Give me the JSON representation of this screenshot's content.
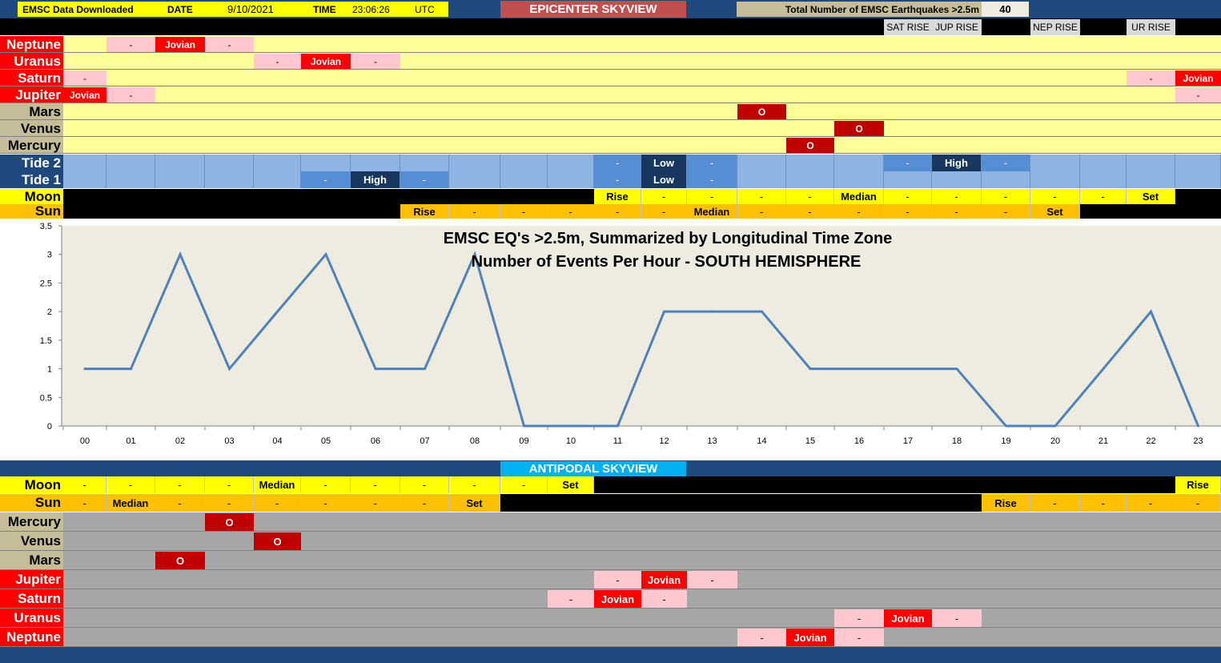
{
  "header": {
    "downloaded_label": "EMSC Data Downloaded",
    "date_label": "DATE",
    "date_value": "9/10/2021",
    "time_label": "TIME",
    "time_value": "23:06:26",
    "tz_label": "UTC",
    "title": "EPICENTER SKYVIEW",
    "total_label": "Total Number of EMSC Earthquakes >2.5m",
    "total_value": "40",
    "sat_rise": "SAT RISE",
    "jup_rise": "JUP RISE",
    "nep_rise": "NEP RISE",
    "ur_rise": "UR RISE"
  },
  "colors": {
    "navy": "#1f497d",
    "yellow_pale": "#ffff99",
    "pink": "#ffc7ce",
    "red": "#ff0000",
    "dark_red": "#c00000",
    "tide_light": "#8eb4e3",
    "tide_mid": "#558ed5",
    "tide_dark": "#17375e",
    "moon_yellow": "#ffff00",
    "sun_orange": "#ffc000",
    "chart_bg": "#eeece1",
    "line": "#4f81bd",
    "grey": "#a6a6a6",
    "tan": "#c4bd97",
    "antipodal_cyan": "#00b0f0"
  },
  "epicenter": {
    "rows": [
      {
        "label": "Neptune",
        "cells": [
          "",
          "-",
          "Jovian",
          "-",
          "",
          "",
          "",
          "",
          "",
          "",
          "",
          "",
          "",
          "",
          "",
          "",
          "",
          "",
          "",
          "",
          "",
          "",
          "",
          ""
        ]
      },
      {
        "label": "Uranus",
        "cells": [
          "",
          "",
          "",
          "",
          "-",
          "Jovian",
          "-",
          "",
          "",
          "",
          "",
          "",
          "",
          "",
          "",
          "",
          "",
          "",
          "",
          "",
          "",
          "",
          "",
          ""
        ]
      },
      {
        "label": "Saturn",
        "cells": [
          "-",
          "",
          "",
          "",
          "",
          "",
          "",
          "",
          "",
          "",
          "",
          "",
          "",
          "",
          "",
          "",
          "",
          "",
          "",
          "",
          "",
          "",
          "-",
          "Jovian"
        ]
      },
      {
        "label": "Jupiter",
        "cells": [
          "Jovian",
          "-",
          "",
          "",
          "",
          "",
          "",
          "",
          "",
          "",
          "",
          "",
          "",
          "",
          "",
          "",
          "",
          "",
          "",
          "",
          "",
          "",
          "",
          "-"
        ]
      },
      {
        "label": "Mars",
        "cells": [
          "",
          "",
          "",
          "",
          "",
          "",
          "",
          "",
          "",
          "",
          "",
          "",
          "",
          "",
          "O",
          "",
          "",
          "",
          "",
          "",
          "",
          "",
          "",
          ""
        ]
      },
      {
        "label": "Venus",
        "cells": [
          "",
          "",
          "",
          "",
          "",
          "",
          "",
          "",
          "",
          "",
          "",
          "",
          "",
          "",
          "",
          "",
          "O",
          "",
          "",
          "",
          "",
          "",
          "",
          ""
        ]
      },
      {
        "label": "Mercury",
        "cells": [
          "",
          "",
          "",
          "",
          "",
          "",
          "",
          "",
          "",
          "",
          "",
          "",
          "",
          "",
          "",
          "O",
          "",
          "",
          "",
          "",
          "",
          "",
          "",
          ""
        ]
      }
    ],
    "tide2_label": "Tide 2",
    "tide2": [
      "",
      "",
      "",
      "",
      "",
      "",
      "",
      "",
      "",
      "",
      "",
      "-",
      "Low",
      "-",
      "",
      "",
      "",
      "-",
      "High",
      "-",
      "",
      "",
      "",
      ""
    ],
    "tide1_label": "Tide 1",
    "tide1": [
      "",
      "",
      "",
      "",
      "",
      "-",
      "High",
      "-",
      "",
      "",
      "",
      "-",
      "Low",
      "-",
      "",
      "",
      "",
      "",
      "",
      "",
      "",
      "",
      "",
      ""
    ],
    "moon_label": "Moon",
    "moon": [
      "",
      "",
      "",
      "",
      "",
      "",
      "",
      "",
      "",
      "",
      "",
      "Rise",
      "-",
      "-",
      "-",
      "-",
      "Median",
      "-",
      "-",
      "-",
      "-",
      "-",
      "Set",
      ""
    ],
    "sun_label": "Sun",
    "sun": [
      "",
      "",
      "",
      "",
      "",
      "",
      "",
      "Rise",
      "-",
      "-",
      "-",
      "-",
      "-",
      "Median",
      "-",
      "-",
      "-",
      "-",
      "-",
      "-",
      "Set",
      "",
      "",
      ""
    ]
  },
  "antipodal": {
    "title": "ANTIPODAL SKYVIEW",
    "moon_label": "Moon",
    "moon": [
      "-",
      "-",
      "-",
      "-",
      "Median",
      "-",
      "-",
      "-",
      "-",
      "-",
      "Set",
      "",
      "",
      "",
      "",
      "",
      "",
      "",
      "",
      "",
      "",
      "",
      "",
      "Rise"
    ],
    "sun_label": "Sun",
    "sun": [
      "-",
      "Median",
      "-",
      "-",
      "-",
      "-",
      "-",
      "-",
      "Set",
      "",
      "",
      "",
      "",
      "",
      "",
      "",
      "",
      "",
      "",
      "Rise",
      "-",
      "-",
      "-",
      "-"
    ],
    "rows": [
      {
        "label": "Mercury",
        "cells": [
          "",
          "",
          "",
          "O",
          "",
          "",
          "",
          "",
          "",
          "",
          "",
          "",
          "",
          "",
          "",
          "",
          "",
          "",
          "",
          "",
          "",
          "",
          "",
          ""
        ]
      },
      {
        "label": "Venus",
        "cells": [
          "",
          "",
          "",
          "",
          "O",
          "",
          "",
          "",
          "",
          "",
          "",
          "",
          "",
          "",
          "",
          "",
          "",
          "",
          "",
          "",
          "",
          "",
          "",
          ""
        ]
      },
      {
        "label": "Mars",
        "cells": [
          "",
          "",
          "O",
          "",
          "",
          "",
          "",
          "",
          "",
          "",
          "",
          "",
          "",
          "",
          "",
          "",
          "",
          "",
          "",
          "",
          "",
          "",
          "",
          ""
        ]
      },
      {
        "label": "Jupiter",
        "cells": [
          "",
          "",
          "",
          "",
          "",
          "",
          "",
          "",
          "",
          "",
          "",
          "-",
          "Jovian",
          "-",
          "",
          "",
          "",
          "",
          "",
          "",
          "",
          "",
          "",
          ""
        ]
      },
      {
        "label": "Saturn",
        "cells": [
          "",
          "",
          "",
          "",
          "",
          "",
          "",
          "",
          "",
          "",
          "-",
          "Jovian",
          "-",
          "",
          "",
          "",
          "",
          "",
          "",
          "",
          "",
          "",
          "",
          ""
        ]
      },
      {
        "label": "Uranus",
        "cells": [
          "",
          "",
          "",
          "",
          "",
          "",
          "",
          "",
          "",
          "",
          "",
          "",
          "",
          "",
          "",
          "",
          "-",
          "Jovian",
          "-",
          "",
          "",
          "",
          "",
          ""
        ]
      },
      {
        "label": "Neptune",
        "cells": [
          "",
          "",
          "",
          "",
          "",
          "",
          "",
          "",
          "",
          "",
          "",
          "",
          "",
          "",
          "-",
          "Jovian",
          "-",
          "",
          "",
          "",
          "",
          "",
          "",
          ""
        ]
      }
    ]
  },
  "chart_data": {
    "type": "line",
    "title": "EMSC EQ's >2.5m, Summarized by Longitudinal Time Zone",
    "subtitle": "Number of Events Per Hour - SOUTH HEMISPHERE",
    "categories": [
      "00",
      "01",
      "02",
      "03",
      "04",
      "05",
      "06",
      "07",
      "08",
      "09",
      "10",
      "11",
      "12",
      "13",
      "14",
      "15",
      "16",
      "17",
      "18",
      "19",
      "20",
      "21",
      "22",
      "23"
    ],
    "values": [
      1,
      1,
      3,
      1,
      2,
      3,
      1,
      1,
      3,
      0,
      0,
      0,
      2,
      2,
      2,
      1,
      1,
      1,
      1,
      0,
      0,
      1,
      2,
      0
    ],
    "ylim": [
      0,
      3.5
    ],
    "yticks": [
      "0",
      "0.5",
      "1",
      "1.5",
      "2",
      "2.5",
      "3",
      "3.5"
    ],
    "xlabel": "",
    "ylabel": "",
    "grid": false,
    "legend": "none"
  }
}
